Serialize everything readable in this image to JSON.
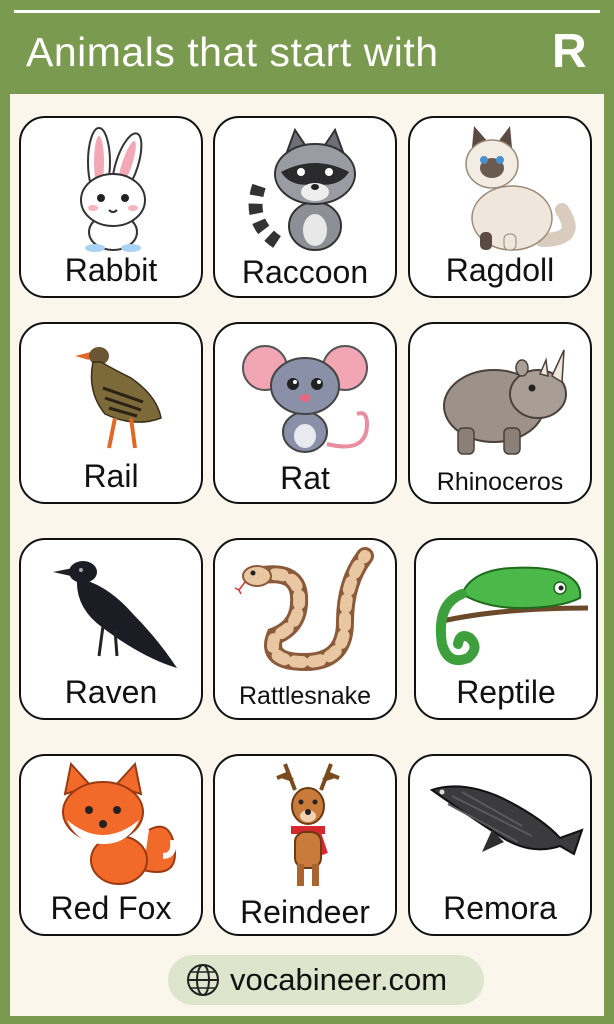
{
  "title": "Animals that start with",
  "letter": "R",
  "colors": {
    "accent": "#7a9a4f",
    "panel": "#fbf6ec",
    "footer": "#dde5cc"
  },
  "cards": [
    {
      "name": "Rabbit",
      "icon": "rabbit-icon"
    },
    {
      "name": "Raccoon",
      "icon": "raccoon-icon"
    },
    {
      "name": "Ragdoll",
      "icon": "ragdoll-cat-icon"
    },
    {
      "name": "Rail",
      "icon": "rail-bird-icon"
    },
    {
      "name": "Rat",
      "icon": "rat-icon"
    },
    {
      "name": "Rhinoceros",
      "icon": "rhinoceros-icon"
    },
    {
      "name": "Raven",
      "icon": "raven-icon"
    },
    {
      "name": "Rattlesnake",
      "icon": "rattlesnake-icon"
    },
    {
      "name": "Reptile",
      "icon": "chameleon-icon"
    },
    {
      "name": "Red Fox",
      "icon": "red-fox-icon"
    },
    {
      "name": "Reindeer",
      "icon": "reindeer-icon"
    },
    {
      "name": "Remora",
      "icon": "remora-fish-icon"
    }
  ],
  "footer": {
    "site": "vocabineer.com",
    "icon": "globe-icon"
  }
}
